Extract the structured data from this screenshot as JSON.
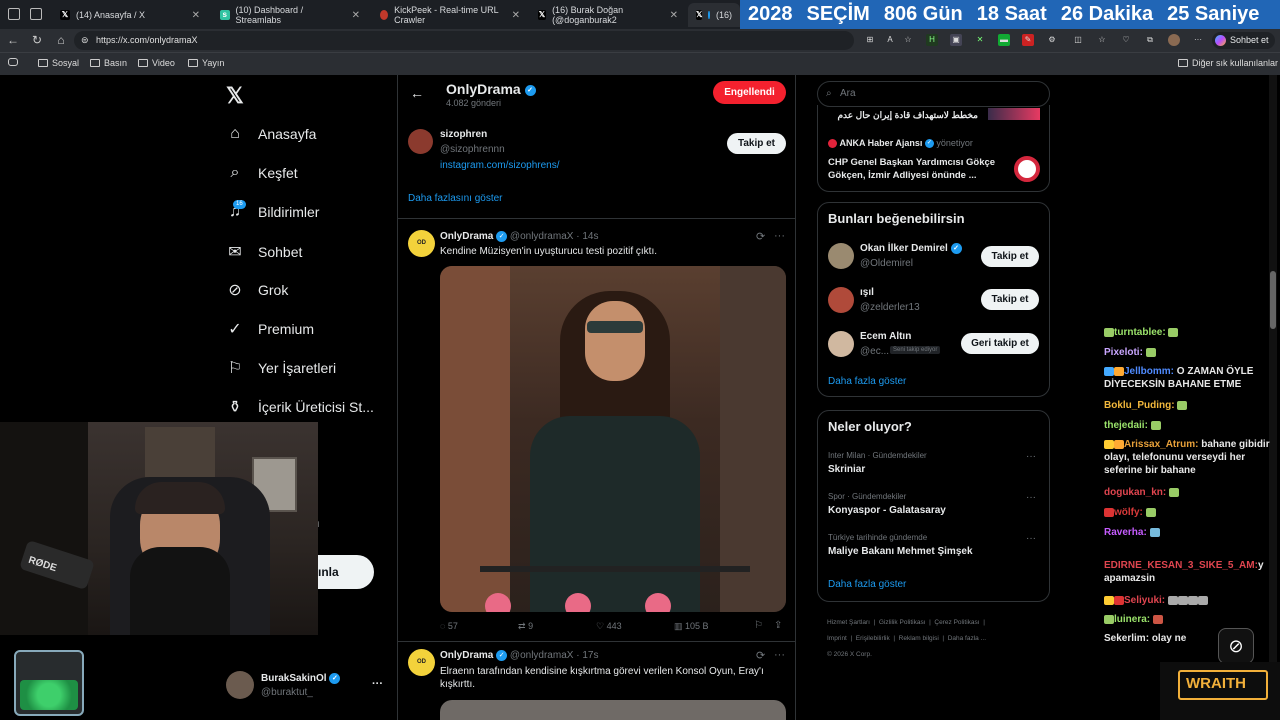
{
  "tabs": [
    {
      "label": "(14) Anasayfa / X",
      "icon": "x-logo",
      "active": false
    },
    {
      "label": "(10) Dashboard / Streamlabs",
      "icon": "streamlabs-logo",
      "active": false
    },
    {
      "label": "KickPeek - Real-time URL Crawler",
      "icon": "kickpeek-logo",
      "active": false
    },
    {
      "label": "(16) Burak Doğan (@doganburak2",
      "icon": "x-logo",
      "active": false
    },
    {
      "label": "(16)",
      "icon": "x-logo",
      "active": true
    }
  ],
  "countdown": {
    "year": "2028",
    "label": "SEÇİM",
    "days": "806 Gün",
    "hours": "18 Saat",
    "minutes": "26 Dakika",
    "seconds": "25 Saniye"
  },
  "address": {
    "url": "https://x.com/onlydramaX"
  },
  "ext_sohbet": "Sohbet et",
  "bookmarks": [
    "Sosyal",
    "Basın",
    "Video",
    "Yayın"
  ],
  "bookmarks_other": "Diğer sık kullanılanlar",
  "sidebar": {
    "items": [
      "Anasayfa",
      "Keşfet",
      "Bildirimler",
      "Sohbet",
      "Grok",
      "Premium",
      "Yer İşaretleri",
      "İçerik Üreticisi St..."
    ],
    "notif_badge": "16",
    "partial_button": "ınla",
    "partial_letter": "n",
    "account": {
      "name": "BurakSakinOl",
      "handle": "@buraktut_"
    }
  },
  "header": {
    "name": "OnlyDrama",
    "posts": "4.082 gönderi",
    "blocked_label": "Engellendi"
  },
  "suggested_user": {
    "name": "sizophren",
    "handle": "@sizophrennn",
    "link": "instagram.com/sizophrens/",
    "follow": "Takip et"
  },
  "show_more": "Daha fazlasını göster",
  "tweets": [
    {
      "name": "OnlyDrama",
      "handle": "@onlydramaX",
      "time": "14s",
      "text": "Kendine Müzisyen'in uyuşturucu testi pozitif çıktı.",
      "replies": "57",
      "retweets": "9",
      "likes": "443",
      "views": "105 B"
    },
    {
      "name": "OnlyDrama",
      "handle": "@onlydramaX",
      "time": "17s",
      "text": "Elraenn tarafından kendisine kışkırtma görevi verilen Konsol Oyun, Eray'ı kışkırttı."
    }
  ],
  "search": {
    "placeholder": "Ara"
  },
  "top_news": [
    {
      "text": "مخطط لاستهداف قادة إيران حال عدم"
    },
    {
      "source": "ANKA Haber Ajansı",
      "suffix": "yönetiyor",
      "text": "CHP Genel Başkan Yardımcısı Gökçe Gökçen, İzmir Adliyesi önünde ..."
    }
  ],
  "who_to_follow": {
    "title": "Bunları beğenebilirsin",
    "users": [
      {
        "name": "Okan İlker Demirel",
        "handle": "@Oldemirel",
        "button": "Takip et"
      },
      {
        "name": "ışıl",
        "handle": "@zelderler13",
        "button": "Takip et"
      },
      {
        "name": "Ecem Altın",
        "handle": "@ec...",
        "note": "Seni takip ediyor",
        "button": "Geri takip et"
      }
    ],
    "more": "Daha fazla göster"
  },
  "trends": {
    "title": "Neler oluyor?",
    "items": [
      {
        "context": "Inter Milan · Gündemdekiler",
        "topic": "Skriniar"
      },
      {
        "context": "Spor · Gündemdekiler",
        "topic": "Konyaspor - Galatasaray"
      },
      {
        "context": "Türkiye tarihinde gündemde",
        "topic": "Maliye Bakanı Mehmet Şimşek"
      }
    ],
    "more": "Daha fazla göster"
  },
  "footer": {
    "links": [
      "Hizmet Şartları",
      "Gizlilik Politikası",
      "Çerez Politikası",
      "Imprint",
      "Erişilebilirlik",
      "Reklam bilgisi",
      "Daha fazla ..."
    ],
    "copyright": "© 2026 X Corp."
  },
  "chat": [
    {
      "user": "turntablee:",
      "msg": "",
      "color": "#9be36b"
    },
    {
      "user": "Pixeloti:",
      "msg": "",
      "color": "#c9a6ff"
    },
    {
      "user": "Jellbomm:",
      "msg": "O ZAMAN ÖYLE DİYECEKSİN BAHANE ETME",
      "color": "#4f8bff"
    },
    {
      "user": "Boklu_Puding:",
      "msg": "",
      "color": "#f2b83c"
    },
    {
      "user": "thejedaii:",
      "msg": "",
      "color": "#9be36b"
    },
    {
      "user": "Arissax_Atrum:",
      "msg": "bahane gibidir olayı, telefonunu verseydi her seferine bir bahane",
      "color": "#e8a13a"
    },
    {
      "user": "dogukan_kn:",
      "msg": "",
      "color": "#e0454f"
    },
    {
      "user": "wölfy:",
      "msg": "",
      "color": "#d93a3a"
    },
    {
      "user": "Raverha:",
      "msg": "",
      "color": "#c65cff"
    },
    {
      "user": "EDIRNE_KESAN_3_SIKE_5_AM:",
      "msg": "y apamazsin",
      "color": "#e0454f"
    },
    {
      "user": "Seliyuki:",
      "msg": "",
      "color": "#e0454f"
    },
    {
      "user": "luinera:",
      "msg": "",
      "color": "#9be36b"
    },
    {
      "user": "Sekerlim:",
      "msg": "olay ne",
      "color": "#e8e8e8"
    }
  ],
  "overlay": {
    "mic_label": "RØDE",
    "wraith_label": "WRAITH"
  }
}
